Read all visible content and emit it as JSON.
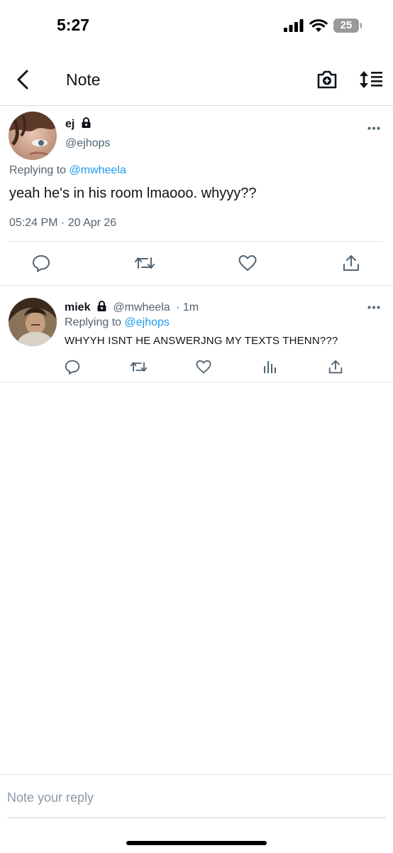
{
  "status_bar": {
    "time": "5:27",
    "battery": "25"
  },
  "header": {
    "title": "Note",
    "icons": {
      "back": "chevron-left-icon",
      "camera": "camera-plus-icon",
      "sort": "sort-lines-icon"
    }
  },
  "main_note": {
    "name": "ej",
    "handle": "@ejhops",
    "replying_prefix": "Replying to",
    "replying_to": "@mwheela",
    "text": "yeah he's in his room lmaooo. whyyy??",
    "timestamp": "05:24 PM · 20 Apr 26",
    "actions": [
      "reply-icon",
      "repost-icon",
      "like-icon",
      "share-icon"
    ]
  },
  "reply_note": {
    "name": "miek",
    "handle": "@mwheela",
    "time": "· 1m",
    "replying_prefix": "Replying to",
    "replying_to": "@ejhops",
    "text": "WHYYH ISNT HE ANSWERJNG MY TEXTS THENN???",
    "actions": [
      "reply-icon",
      "repost-icon",
      "like-icon",
      "views-icon",
      "share-icon"
    ]
  },
  "composer": {
    "placeholder": "Note your reply"
  },
  "colors": {
    "accent": "#1d9bf0",
    "secondary_text": "#536471",
    "primary_text": "#0f1419"
  }
}
